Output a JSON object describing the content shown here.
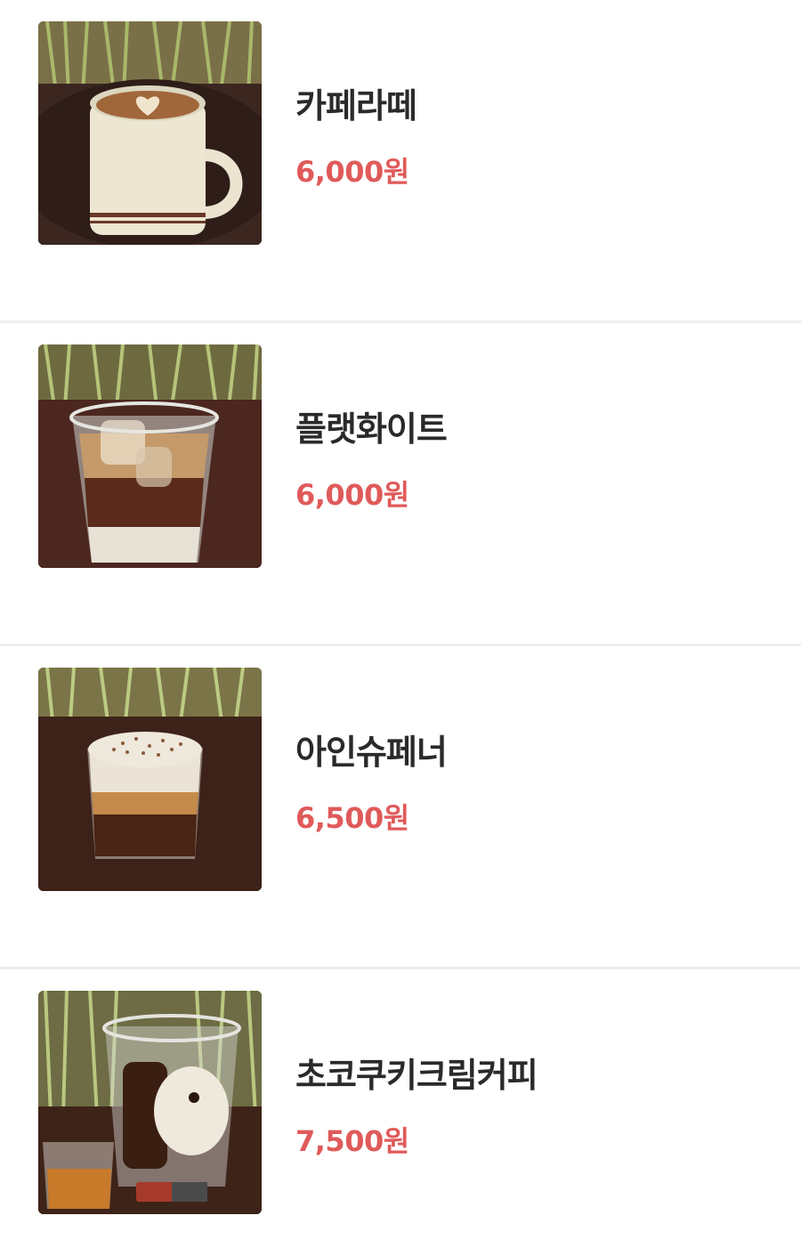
{
  "menu": {
    "items": [
      {
        "name": "카페라떼",
        "price": "6,000원",
        "image": "cafe-latte-photo"
      },
      {
        "name": "플랫화이트",
        "price": "6,000원",
        "image": "flat-white-photo"
      },
      {
        "name": "아인슈페너",
        "price": "6,500원",
        "image": "einspanner-photo"
      },
      {
        "name": "초코쿠키크림커피",
        "price": "7,500원",
        "image": "choco-cookie-cream-coffee-photo"
      }
    ]
  },
  "colors": {
    "name": "#2a2a2a",
    "price": "#e05a5a",
    "divider": "#eeeeee",
    "background": "#ffffff"
  }
}
